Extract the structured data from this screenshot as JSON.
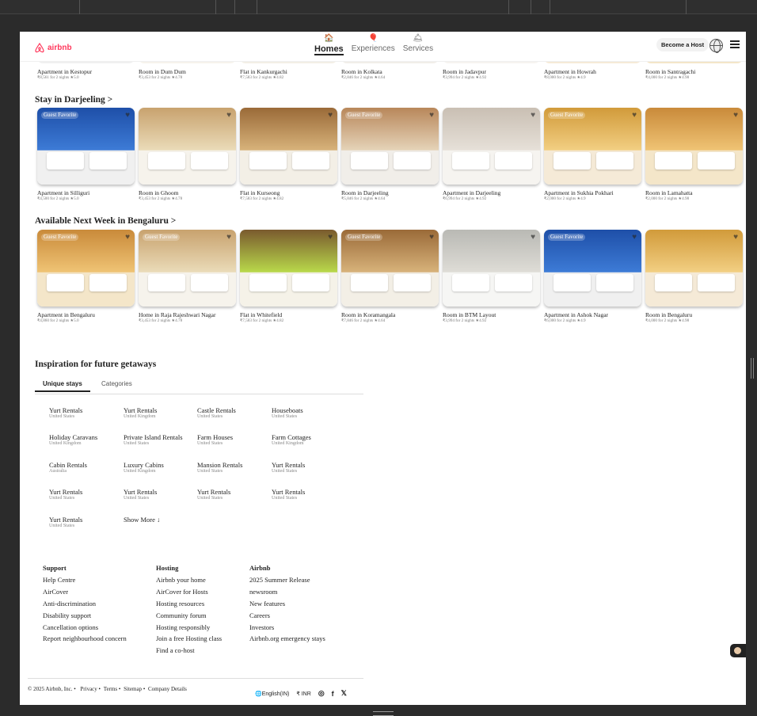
{
  "header": {
    "logo": "airbnb",
    "nav": [
      {
        "label": "Homes",
        "icon": "house-icon"
      },
      {
        "label": "Experiences",
        "icon": "balloon-icon"
      },
      {
        "label": "Services",
        "icon": "bell-icon"
      }
    ],
    "host_button": "Become a Host"
  },
  "top_row": [
    {
      "title": "Apartment in Kestopur",
      "sub": "₹8,561 for 2 nights ★5.0"
    },
    {
      "title": "Room in Dum Dum",
      "sub": "₹3,453 for 2 nights ★4.78"
    },
    {
      "title": "Flat in Kankurgachi",
      "sub": "₹7,583 for 2 nights ★4.82"
    },
    {
      "title": "Room in Kolkata",
      "sub": "₹2,846 for 2 nights ★4.64"
    },
    {
      "title": "Room in Jadavpur",
      "sub": "₹3,994 for 2 nights ★4.92"
    },
    {
      "title": "Apartment in Howrah",
      "sub": "₹8,000 for 2 nights ★4.9"
    },
    {
      "title": "Room in Santragachi",
      "sub": "₹4,000 for 2 nights ★4.98"
    }
  ],
  "section1": {
    "title": "Stay in Darjeeling >",
    "cards": [
      {
        "title": "Apartment in Silliguri",
        "sub": "₹4,500 for 2 nights ★5.0",
        "badge": "Guest Favorite"
      },
      {
        "title": "Room in Ghoom",
        "sub": "₹3,453 for 2 nights ★4.78",
        "badge": ""
      },
      {
        "title": "Flat in Kurseong",
        "sub": "₹7,583 for 2 nights ★4.82",
        "badge": ""
      },
      {
        "title": "Room in Darjeeling",
        "sub": "₹5,846 for 2 nights ★4.64",
        "badge": "Guest Favorite"
      },
      {
        "title": "Apartment in Darjeeling",
        "sub": "₹6,994 for 2 nights ★4.92",
        "badge": ""
      },
      {
        "title": "Apartment in Sukhia Pokhari",
        "sub": "₹2,000 for 2 nights ★4.9",
        "badge": "Guest Favorite"
      },
      {
        "title": "Room in Lamahatta",
        "sub": "₹2,000 for 2 nights ★4.98",
        "badge": ""
      }
    ]
  },
  "section2": {
    "title": "Available Next Week in Bengaluru >",
    "cards": [
      {
        "title": "Apartment in Bengaluru",
        "sub": "₹4,860 for 2 nights ★5.0",
        "badge": "Guest Favorite"
      },
      {
        "title": "Home in Raja Rajeshwari Nagar",
        "sub": "₹3,453 for 2 nights ★4.78",
        "badge": "Guest Favorite"
      },
      {
        "title": "Flat in Whitefield",
        "sub": "₹7,583 for 2 nights ★4.82",
        "badge": ""
      },
      {
        "title": "Room in Koramangala",
        "sub": "₹7,846 for 2 nights ★4.64",
        "badge": "Guest Favorite"
      },
      {
        "title": "Room in BTM Layout",
        "sub": "₹3,994 for 2 nights ★4.92",
        "badge": ""
      },
      {
        "title": "Apartment in Ashok Nagar",
        "sub": "₹6,000 for 2 nights ★4.9",
        "badge": "Guest Favorite"
      },
      {
        "title": "Room in Bengaluru",
        "sub": "₹4,000 for 2 nights ★4.98",
        "badge": ""
      }
    ]
  },
  "inspiration": {
    "title": "Inspiration for future getaways",
    "tabs": [
      "Unique stays",
      "Categories"
    ],
    "items": [
      {
        "title": "Yurt Rentals",
        "sub": "United States"
      },
      {
        "title": "Yurt Rentals",
        "sub": "United Kingdom"
      },
      {
        "title": "Castle Rentals",
        "sub": "United States"
      },
      {
        "title": "Houseboats",
        "sub": "United States"
      },
      {
        "title": "Holiday Caravans",
        "sub": "United Kingdom"
      },
      {
        "title": "Private Island Rentals",
        "sub": "United States"
      },
      {
        "title": "Farm Houses",
        "sub": "United States"
      },
      {
        "title": "Farm Cottages",
        "sub": "United Kingdom"
      },
      {
        "title": "Cabin Rentals",
        "sub": "Australia"
      },
      {
        "title": "Luxury Cabins",
        "sub": "United Kingdom"
      },
      {
        "title": "Mansion Rentals",
        "sub": "United States"
      },
      {
        "title": "Yurt Rentals",
        "sub": "United States"
      },
      {
        "title": "Yurt Rentals",
        "sub": "United States"
      },
      {
        "title": "Yurt Rentals",
        "sub": "United States"
      },
      {
        "title": "Yurt Rentals",
        "sub": "United States"
      },
      {
        "title": "Yurt Rentals",
        "sub": "United States"
      },
      {
        "title": "Yurt Rentals",
        "sub": "United States"
      }
    ],
    "show_more": "Show More ↓"
  },
  "footer": {
    "columns": [
      {
        "title": "Support",
        "links": [
          "Help Centre",
          "AirCover",
          "Anti-discrimination",
          "Disability support",
          "Cancellation options",
          "Report neighbourhood concern"
        ]
      },
      {
        "title": "Hosting",
        "links": [
          "Airbnb your home",
          "AirCover for Hosts",
          "Hosting resources",
          "Community forum",
          "Hosting responsibly",
          "Join a free Hosting class",
          "Find a co-host"
        ]
      },
      {
        "title": "Airbnb",
        "links": [
          "2025 Summer Release",
          "newsroom",
          "New features",
          "Careers",
          "Investors",
          "Airbnb.org emergency stays"
        ]
      }
    ],
    "copyright": "© 2025 Airbnb, Inc. •",
    "bottom_links": [
      "Privacy",
      "Terms",
      "Sitemap",
      "Company Details"
    ],
    "language": "English(IN)",
    "currency": "₹ INR",
    "social": [
      "instagram-icon",
      "facebook-icon",
      "x-icon"
    ]
  }
}
